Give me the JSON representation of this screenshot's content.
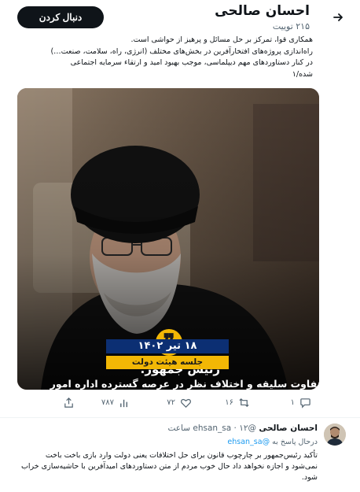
{
  "header": {
    "profile_name": "احسان صالحی",
    "post_count": "۲۱۵ توییت",
    "follow_label": "دنبال کردن"
  },
  "bio_lines": [
    "همکاری قوا، تمرکز بر حل مسائل و پرهیز از حواشی است.",
    "راه‌اندازی پروژه‌های افتخارآفرین در بخش‌های مختلف (انرژی، راه، سلامت، صنعت…)",
    "در کنار دستاوردهای مهم دیپلماسی، موجب بهبود امید و ارتقاء سرمایه اجتماعی",
    "شده/۱"
  ],
  "media": {
    "speaker": "رئیس جمهور:",
    "headline": "تفاوت سلیقه و اختلاف نظر در عرصه گسترده اداره امور کشور طبیعی است، اما پیگیری موارد اختلافی باید از مبادی قانونی و حقوقی و به دور از هرگونه حاشیه‌آفرینی و ارسال پیام اختلاف باشد.",
    "date": "۱۸ تیر ۱۴۰۲",
    "meeting": "جلسه هیئت دولت",
    "quote_glyph": "❞"
  },
  "actions": {
    "replies": "۱",
    "retweets": "۱۶",
    "likes": "۷۲",
    "views": "۷۸۷"
  },
  "reply": {
    "name": "احسان صالحی",
    "handle": "@ehsan_sa",
    "separator": "·",
    "time": "۱۲ ساعت",
    "replying_to_label": "درحال پاسخ به",
    "replying_to_handle": "@ehsan_sa",
    "text": "تأکید رئیس‌جمهور بر چارچوب قانون برای حل اختلافات یعنی دولت وارد بازی باخت باخت نمی‌شود و اجازه نخواهد داد حال خوب مردم از متن دستاوردهای امیدآفرین با حاشیه‌سازی خراب شود."
  },
  "icons": [
    "back-arrow-icon",
    "reply-icon",
    "retweet-icon",
    "like-icon",
    "views-icon",
    "share-icon"
  ],
  "colors": {
    "text": "#0f1419",
    "secondary": "#536471",
    "link": "#1d9bf0",
    "follow_button": "#0f1419",
    "date_band": "#0c2f73",
    "accent_yellow": "#f2b705"
  }
}
